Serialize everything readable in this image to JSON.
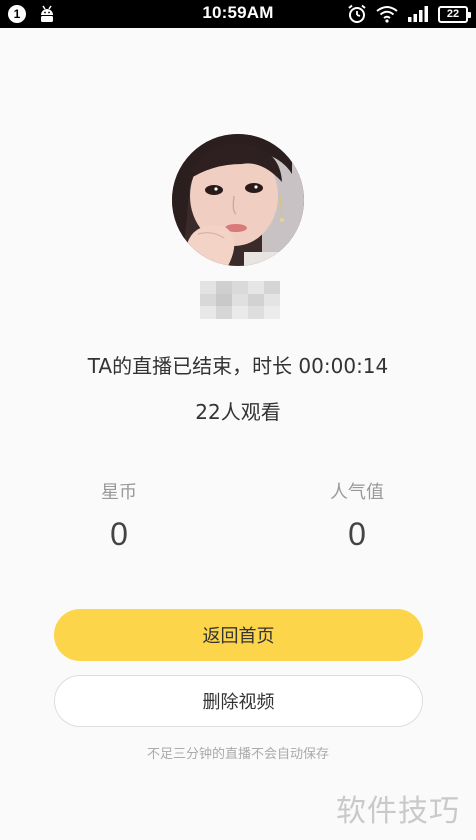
{
  "status_bar": {
    "notification_count": "1",
    "time": "10:59AM",
    "battery_level": "22",
    "icons": [
      "android-icon",
      "alarm-icon",
      "wifi-icon",
      "signal-icon",
      "battery-icon"
    ]
  },
  "live_end": {
    "message": "TA的直播已结束，时长 00:00:14",
    "viewers": "22人观看"
  },
  "stats": {
    "coins_label": "星币",
    "coins_value": "0",
    "popularity_label": "人气值",
    "popularity_value": "0"
  },
  "actions": {
    "home_label": "返回首页",
    "delete_label": "删除视频"
  },
  "hint": "不足三分钟的直播不会自动保存",
  "watermark": "软件技巧",
  "colors": {
    "accent": "#fcd54a",
    "background": "#fafafa",
    "status_bar": "#000000"
  }
}
